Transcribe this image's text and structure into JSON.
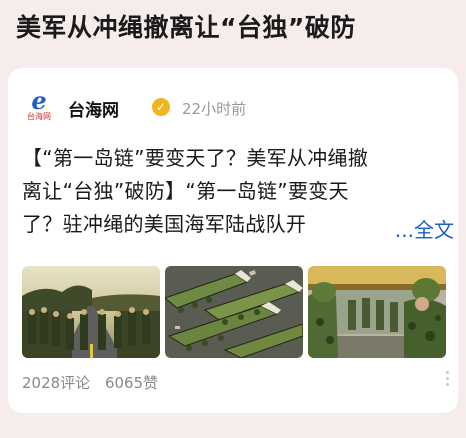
{
  "headline": "美军从冲绳撤离让“台独”破防",
  "post": {
    "source_name": "台海网",
    "logo_text": "台海网",
    "time": "22小时前",
    "body_lines": [
      "【“第一岛链”要变天了？美军从冲绳撤",
      "离让“台独”破防】“第一岛链”要变天",
      "了？驻冲绳的美国海军陆战队开"
    ],
    "more_label": "...全文",
    "comments": "2028评论",
    "likes": "6065赞"
  },
  "colors": {
    "accent": "#1f5fbf",
    "verified": "#f2b51d",
    "background": "#f7ecec"
  },
  "icons": {
    "verified": "verified-badge-icon",
    "more": "more-options-icon"
  }
}
